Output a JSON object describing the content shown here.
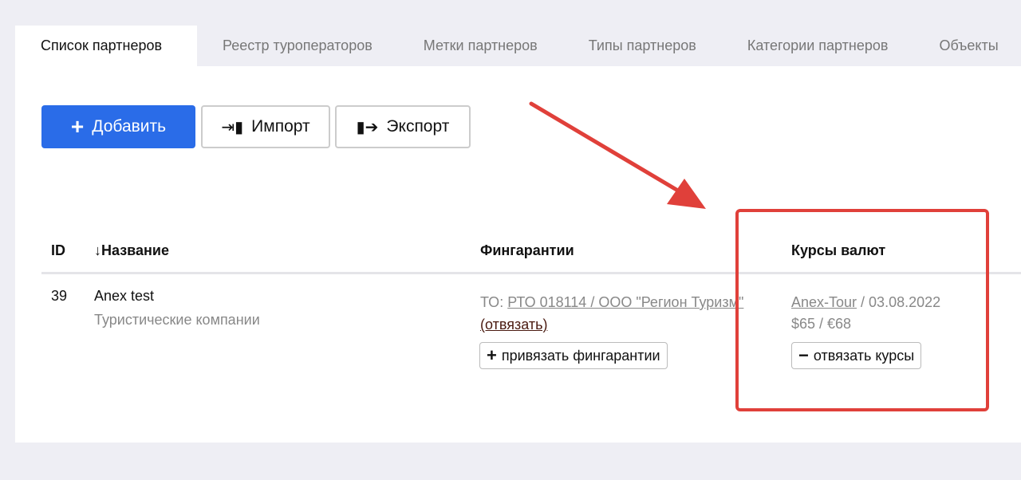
{
  "tabs": [
    "Список партнеров",
    "Реестр туроператоров",
    "Метки партнеров",
    "Типы партнеров",
    "Категории партнеров",
    "Объекты"
  ],
  "toolbar": {
    "add": "Добавить",
    "import": "Импорт",
    "export": "Экспорт"
  },
  "table": {
    "headers": {
      "id": "ID",
      "name": "Название",
      "guarantees": "Фингарантии",
      "rates": "Курсы валют"
    },
    "rows": [
      {
        "id": "39",
        "name": "Anex test",
        "category": "Туристические компании",
        "guarantee_prefix": "ТО: ",
        "guarantee_link": "РТО 018114 / ООО \"Регион Туризм\"",
        "unlink": "(отвязать)",
        "bind_guarantee": "привязать фингарантии",
        "rate_link": "Anex-Tour",
        "rate_date": " / 03.08.2022",
        "rate_values": "$65 / €68",
        "unbind_rates": "отвязать курсы"
      }
    ]
  },
  "colors": {
    "accent": "#2a6ce8",
    "annotation": "#e0403a"
  }
}
